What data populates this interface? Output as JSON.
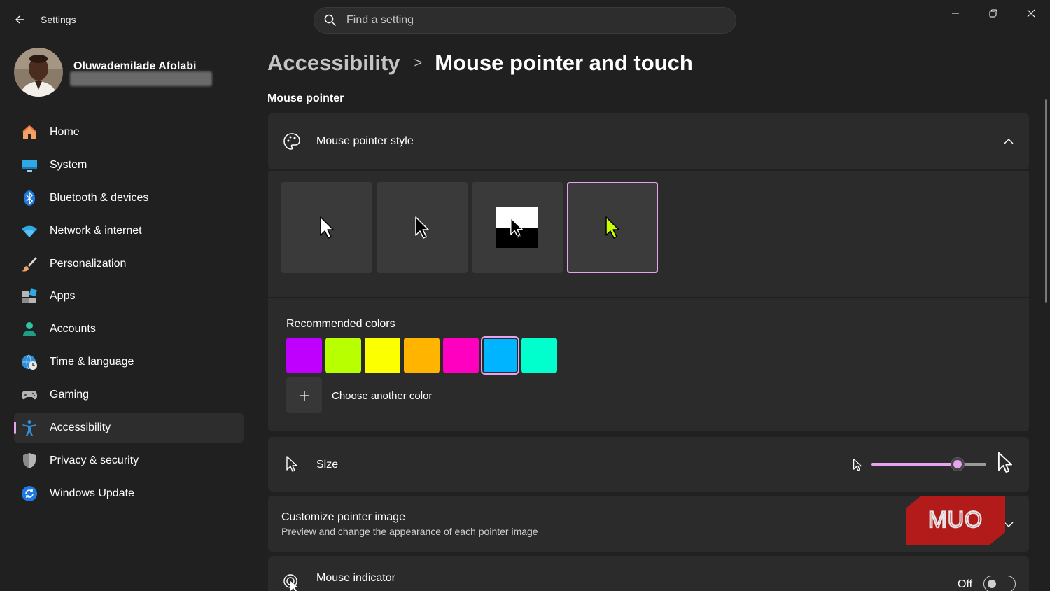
{
  "window": {
    "title": "Settings",
    "search_placeholder": "Find a setting"
  },
  "profile": {
    "name": "Oluwademilade Afolabi"
  },
  "sidebar": {
    "items": [
      {
        "label": "Home",
        "icon": "home-icon"
      },
      {
        "label": "System",
        "icon": "system-icon"
      },
      {
        "label": "Bluetooth & devices",
        "icon": "bluetooth-icon"
      },
      {
        "label": "Network & internet",
        "icon": "wifi-icon"
      },
      {
        "label": "Personalization",
        "icon": "brush-icon"
      },
      {
        "label": "Apps",
        "icon": "apps-icon"
      },
      {
        "label": "Accounts",
        "icon": "account-icon"
      },
      {
        "label": "Time & language",
        "icon": "globe-clock-icon"
      },
      {
        "label": "Gaming",
        "icon": "gamepad-icon"
      },
      {
        "label": "Accessibility",
        "icon": "accessibility-icon",
        "active": true
      },
      {
        "label": "Privacy & security",
        "icon": "shield-icon"
      },
      {
        "label": "Windows Update",
        "icon": "update-icon"
      }
    ]
  },
  "breadcrumb": {
    "parent": "Accessibility",
    "separator": ">",
    "current": "Mouse pointer and touch"
  },
  "main": {
    "section_title": "Mouse pointer",
    "pointer_style": {
      "title": "Mouse pointer style",
      "styles": [
        "white",
        "black",
        "inverted",
        "custom"
      ],
      "selected_style": "custom",
      "custom_color": "#c5ff00",
      "recommended_label": "Recommended colors",
      "colors": [
        "#bf00ff",
        "#b8ff00",
        "#fcff00",
        "#ffb400",
        "#ff00c0",
        "#00b4ff",
        "#00ffcc"
      ],
      "selected_color_index": 5,
      "choose_label": "Choose another color"
    },
    "size": {
      "title": "Size",
      "value_fraction": 0.75
    },
    "customize": {
      "title": "Customize pointer image",
      "subtitle": "Preview and change the appearance of each pointer image"
    },
    "indicator": {
      "title": "Mouse indicator",
      "toggle_label": "Off"
    }
  },
  "watermark": {
    "text": "MUO",
    "color": "#b31b1b"
  },
  "colors": {
    "accent": "#e8a3f0",
    "background": "#202020",
    "card": "#2b2b2b"
  }
}
